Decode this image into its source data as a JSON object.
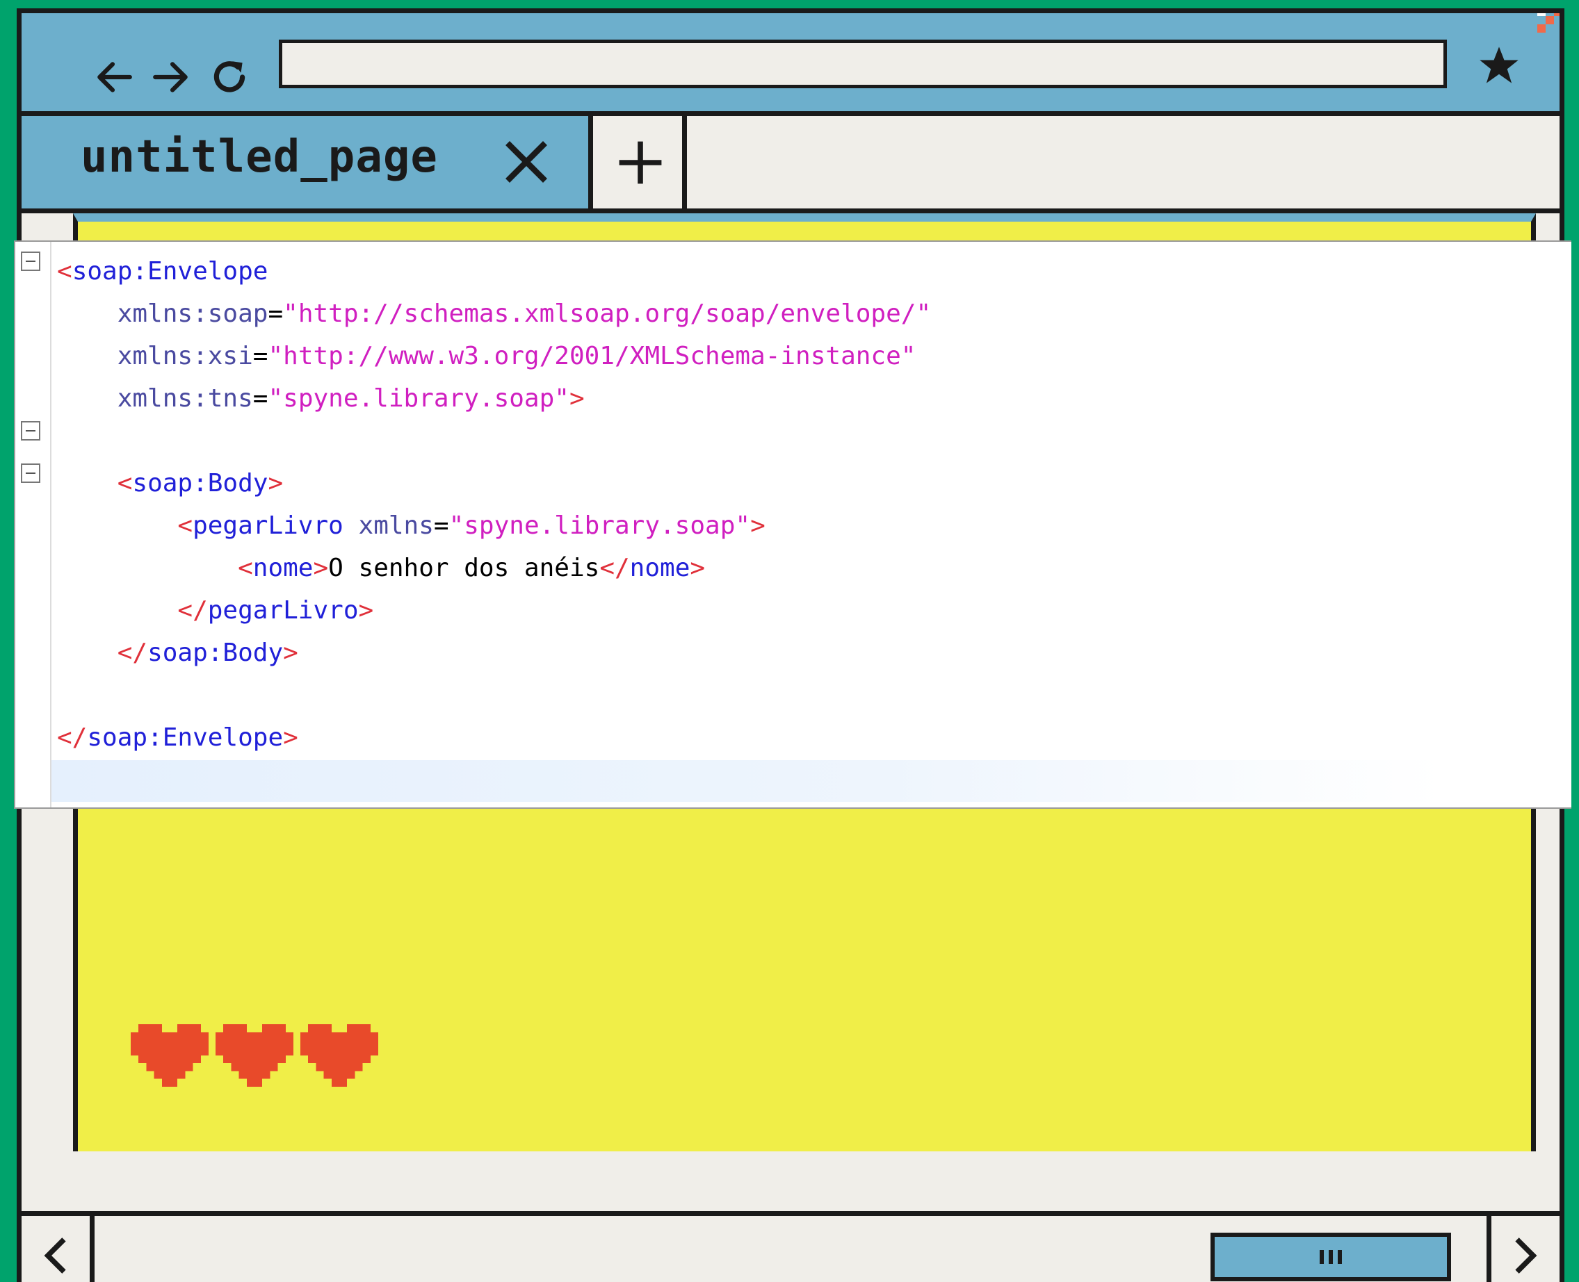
{
  "browser": {
    "tab_title": "untitled_page",
    "address_value": ""
  },
  "icons": {
    "back": "arrow-left-icon",
    "forward": "arrow-right-icon",
    "reload": "reload-icon",
    "bookmark": "star-icon",
    "close_tab": "close-icon",
    "new_tab": "plus-icon",
    "scroll_left": "chevron-left-icon",
    "scroll_right": "chevron-right-icon",
    "scroll_grip": "grip-icon",
    "hearts": "heart-icon"
  },
  "colors": {
    "chrome_blue": "#6dafcc",
    "page_yellow": "#f0ee48",
    "outer_green": "#00a36c",
    "heart_red": "#e84a2a",
    "xml_bracket": "#e0303a",
    "xml_tag": "#2020d8",
    "xml_attr": "#4a4aa0",
    "xml_value": "#d01fc0"
  },
  "game": {
    "lives": 3
  },
  "editor": {
    "lines": [
      {
        "indent": "",
        "parts": [
          [
            "b",
            "<"
          ],
          [
            "t",
            "soap:Envelope"
          ]
        ]
      },
      {
        "indent": "    ",
        "parts": [
          [
            "a",
            "xmlns:soap"
          ],
          [
            "eq",
            "="
          ],
          [
            "v",
            "\"http://schemas.xmlsoap.org/soap/envelope/\""
          ]
        ]
      },
      {
        "indent": "    ",
        "parts": [
          [
            "a",
            "xmlns:xsi"
          ],
          [
            "eq",
            "="
          ],
          [
            "v",
            "\"http://www.w3.org/2001/XMLSchema-instance\""
          ]
        ]
      },
      {
        "indent": "    ",
        "parts": [
          [
            "a",
            "xmlns:tns"
          ],
          [
            "eq",
            "="
          ],
          [
            "v",
            "\"spyne.library.soap\""
          ],
          [
            "b",
            ">"
          ]
        ]
      },
      {
        "indent": "",
        "parts": []
      },
      {
        "indent": "    ",
        "parts": [
          [
            "b",
            "<"
          ],
          [
            "t",
            "soap:Body"
          ],
          [
            "b",
            ">"
          ]
        ]
      },
      {
        "indent": "        ",
        "parts": [
          [
            "b",
            "<"
          ],
          [
            "t",
            "pegarLivro"
          ],
          [
            "txt",
            " "
          ],
          [
            "a",
            "xmlns"
          ],
          [
            "eq",
            "="
          ],
          [
            "v",
            "\"spyne.library.soap\""
          ],
          [
            "b",
            ">"
          ]
        ]
      },
      {
        "indent": "            ",
        "parts": [
          [
            "b",
            "<"
          ],
          [
            "t",
            "nome"
          ],
          [
            "b",
            ">"
          ],
          [
            "txt",
            "O senhor dos anéis"
          ],
          [
            "b",
            "</"
          ],
          [
            "t",
            "nome"
          ],
          [
            "b",
            ">"
          ]
        ]
      },
      {
        "indent": "        ",
        "parts": [
          [
            "b",
            "</"
          ],
          [
            "t",
            "pegarLivro"
          ],
          [
            "b",
            ">"
          ]
        ]
      },
      {
        "indent": "    ",
        "parts": [
          [
            "b",
            "</"
          ],
          [
            "t",
            "soap:Body"
          ],
          [
            "b",
            ">"
          ]
        ]
      },
      {
        "indent": "",
        "parts": []
      },
      {
        "indent": "",
        "parts": [
          [
            "b",
            "</"
          ],
          [
            "t",
            "soap:Envelope"
          ],
          [
            "b",
            ">"
          ]
        ]
      }
    ]
  }
}
